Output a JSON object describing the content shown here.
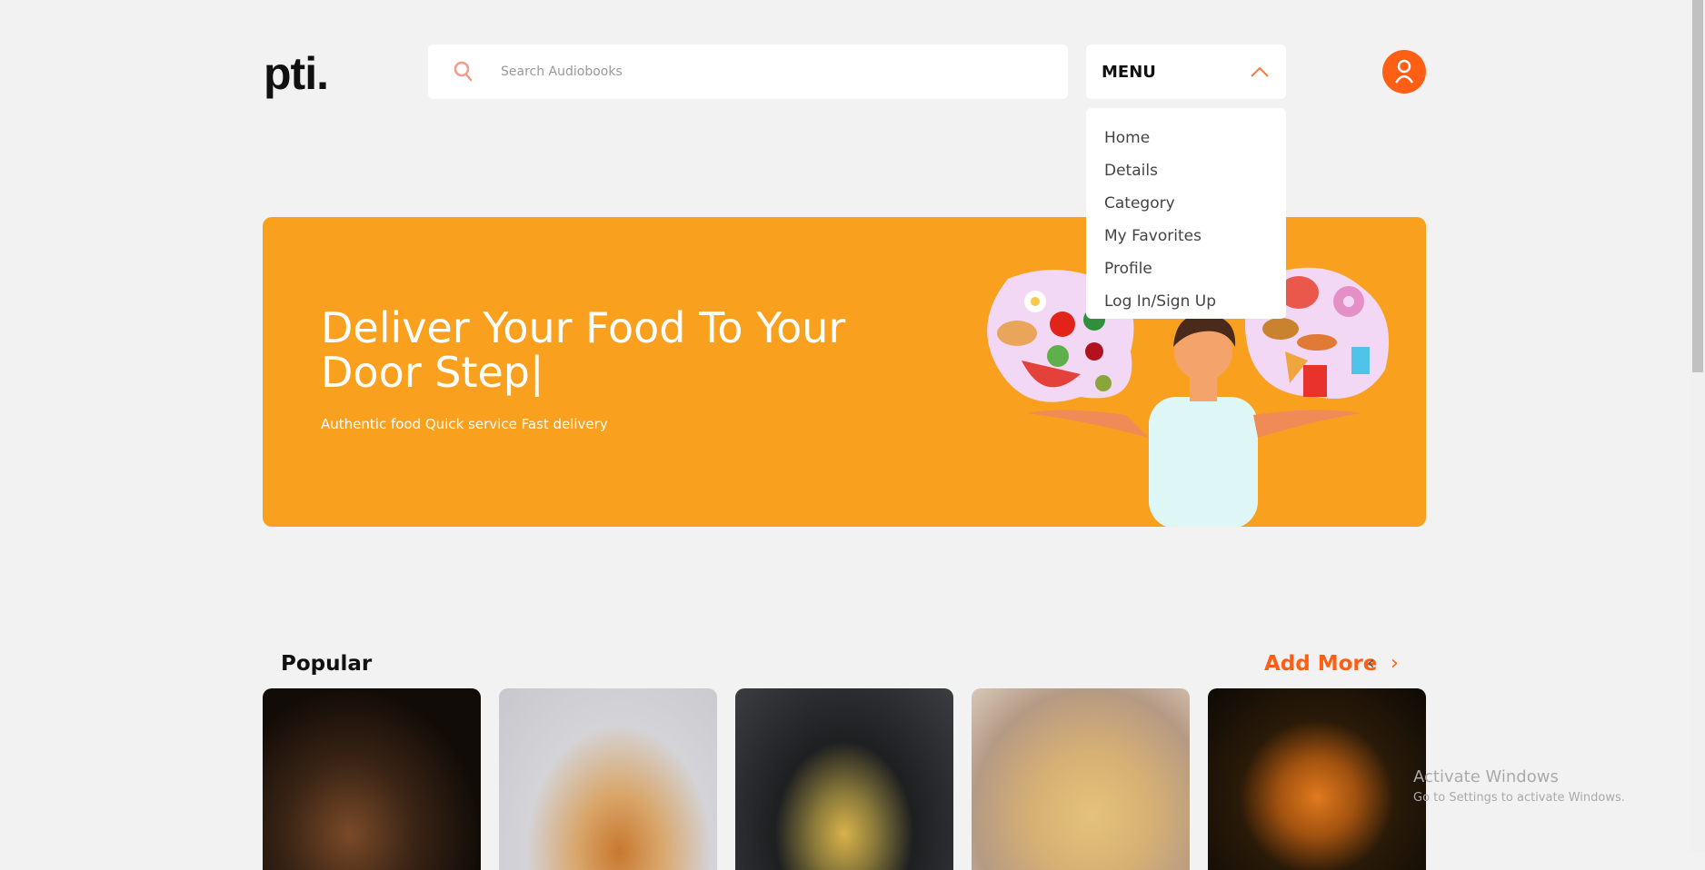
{
  "header": {
    "logo": "pti.",
    "search_placeholder": "Search Audiobooks",
    "menu_label": "MENU"
  },
  "menu": {
    "items": [
      "Home",
      "Details",
      "Category",
      "My Favorites",
      "Profile",
      "Log In/Sign Up"
    ]
  },
  "banner": {
    "headline": "Deliver Your Food To Your Door Step|",
    "subtitle": "Authentic food Quick service Fast delivery"
  },
  "popular": {
    "title": "Popular",
    "add_more": "Add More",
    "prev": "‹",
    "next": "›"
  },
  "watermark": {
    "line1": "Activate Windows",
    "line2": "Go to Settings to activate Windows."
  },
  "colors": {
    "accent": "#ff5f14",
    "banner": "#f9a11e",
    "background": "#f2f2f2"
  }
}
